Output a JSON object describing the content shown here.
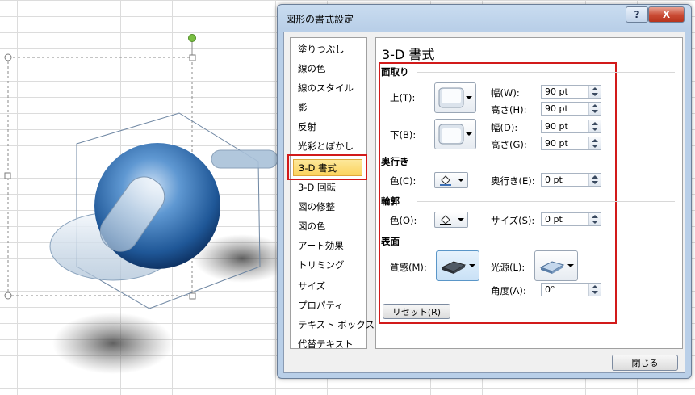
{
  "dialog": {
    "title": "図形の書式設定",
    "help_label": "?",
    "close_label": "X",
    "close_button": "閉じる"
  },
  "nav": {
    "selected_index": 7,
    "items": [
      "塗りつぶし",
      "線の色",
      "線のスタイル",
      "影",
      "反射",
      "光彩とぼかし",
      "3-D 書式",
      "3-D 回転",
      "図の修整",
      "図の色",
      "アート効果",
      "トリミング",
      "サイズ",
      "プロパティ",
      "テキスト ボックス",
      "代替テキスト"
    ]
  },
  "panel": {
    "title": "3-D 書式",
    "bevel": {
      "heading": "面取り",
      "top_label": "上(T):",
      "bottom_label": "下(B):",
      "top_width_label": "幅(W):",
      "top_width_value": "90 pt",
      "top_height_label": "高さ(H):",
      "top_height_value": "90 pt",
      "bottom_width_label": "幅(D):",
      "bottom_width_value": "90 pt",
      "bottom_height_label": "高さ(G):",
      "bottom_height_value": "90 pt"
    },
    "depth": {
      "heading": "奥行き",
      "color_label": "色(C):",
      "depth_label": "奥行き(E):",
      "depth_value": "0 pt"
    },
    "contour": {
      "heading": "輪郭",
      "color_label": "色(O):",
      "size_label": "サイズ(S):",
      "size_value": "0 pt"
    },
    "surface": {
      "heading": "表面",
      "material_label": "質感(M):",
      "lighting_label": "光源(L):",
      "angle_label": "角度(A):",
      "angle_value": "0°"
    },
    "reset_button": "リセット(R)"
  },
  "colors": {
    "highlight_red": "#d21a1a",
    "sphere_blue": "#2e6db4",
    "selected_item": "#fbd35e"
  }
}
